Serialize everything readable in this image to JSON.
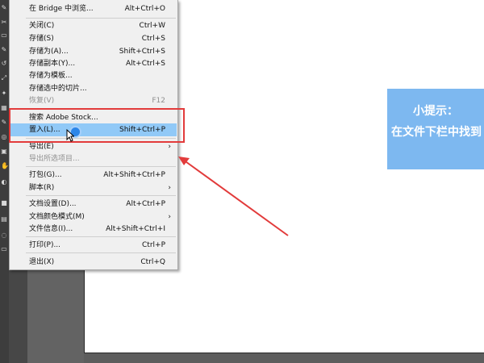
{
  "menu": {
    "items": [
      {
        "label": "在 Bridge 中浏览...",
        "shortcut": "Alt+Ctrl+O"
      },
      {
        "label": "关闭(C)",
        "shortcut": "Ctrl+W"
      },
      {
        "label": "存储(S)",
        "shortcut": "Ctrl+S"
      },
      {
        "label": "存储为(A)...",
        "shortcut": "Shift+Ctrl+S"
      },
      {
        "label": "存储副本(Y)...",
        "shortcut": "Alt+Ctrl+S"
      },
      {
        "label": "存储为模板..."
      },
      {
        "label": "存储选中的切片..."
      },
      {
        "label": "恢复(V)",
        "shortcut": "F12"
      },
      {
        "label": "搜索 Adobe Stock..."
      },
      {
        "label": "置入(L)...",
        "shortcut": "Shift+Ctrl+P"
      },
      {
        "label": "导出(E)"
      },
      {
        "label": "导出所选项目..."
      },
      {
        "label": "打包(G)...",
        "shortcut": "Alt+Shift+Ctrl+P"
      },
      {
        "label": "脚本(R)"
      },
      {
        "label": "文档设置(D)...",
        "shortcut": "Alt+Ctrl+P"
      },
      {
        "label": "文档颜色模式(M)"
      },
      {
        "label": "文件信息(I)...",
        "shortcut": "Alt+Shift+Ctrl+I"
      },
      {
        "label": "打印(P)...",
        "shortcut": "Ctrl+P"
      },
      {
        "label": "退出(X)",
        "shortcut": "Ctrl+Q"
      }
    ],
    "submenu_arrow": "›"
  },
  "tip": {
    "title": "小提示：",
    "body": "在文件下栏中找到"
  },
  "colors": {
    "highlight": "#91c9f7",
    "annotation_red": "#e23b3b",
    "tip_background": "#7db8f0"
  }
}
